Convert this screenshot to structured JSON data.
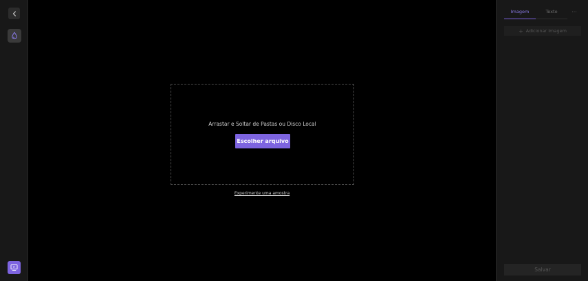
{
  "sidebar": {
    "back_icon": "chevron-left-icon",
    "tool_icon": "drop-icon",
    "bottom_icon": "presentation-icon"
  },
  "canvas": {
    "drop_text": "Arrastar e Soltar de Pastas ou Disco Local",
    "choose_button": "Escolher arquivo",
    "sample_link": "Experimente uma amostra"
  },
  "panel": {
    "tabs": [
      {
        "label": "Imagem",
        "active": true
      },
      {
        "label": "Texto",
        "active": false
      }
    ],
    "more_icon": "ellipsis-icon",
    "add_image_label": "Adicionar Imagem",
    "save_label": "Salvar"
  },
  "colors": {
    "accent": "#7d64e0",
    "background": "#000000",
    "panel": "#181818"
  }
}
